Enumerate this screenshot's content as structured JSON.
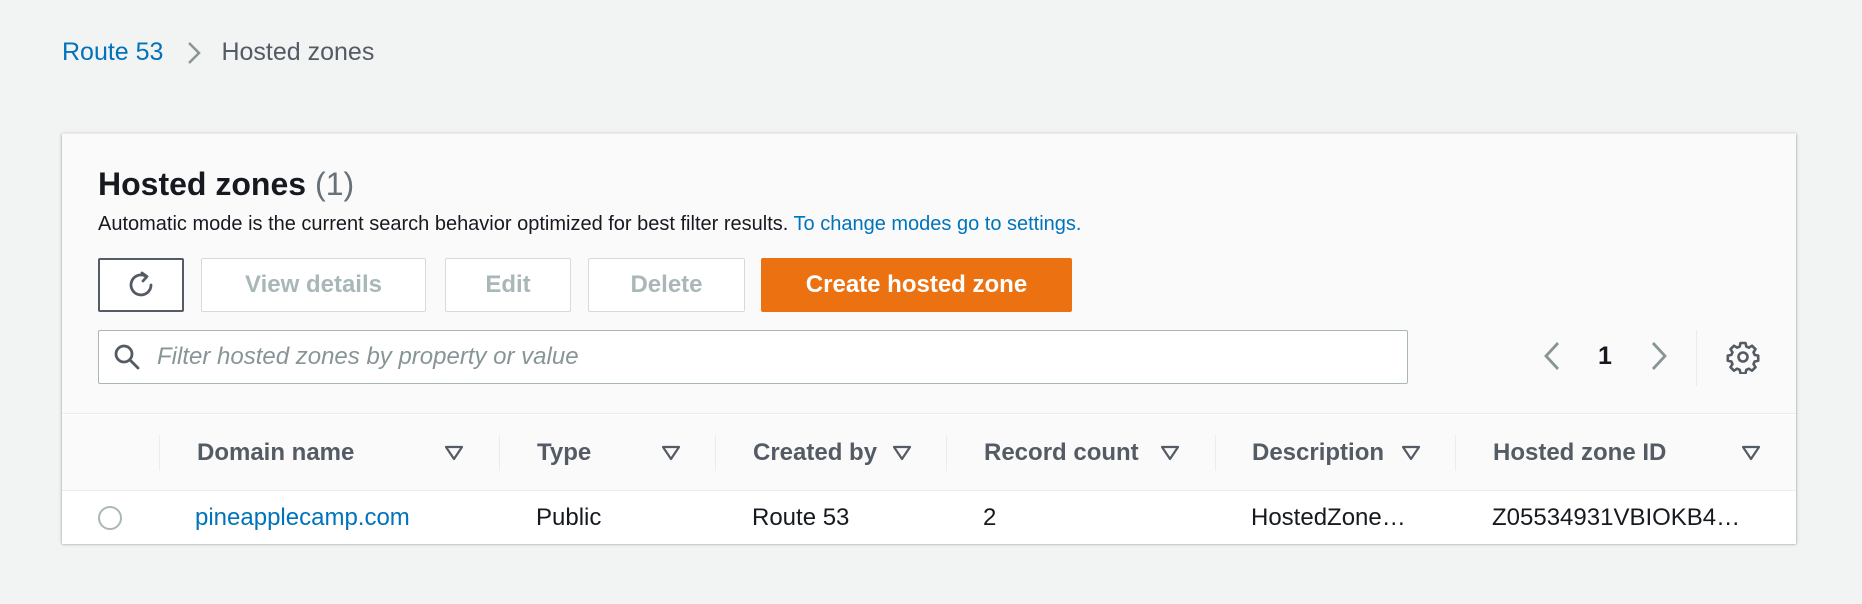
{
  "breadcrumb": {
    "root": "Route 53",
    "current": "Hosted zones"
  },
  "panel": {
    "title": "Hosted zones",
    "count": "(1)",
    "subtitle_text": "Automatic mode is the current search behavior optimized for best filter results.",
    "subtitle_link": "To change modes go to settings."
  },
  "toolbar": {
    "view_details": "View details",
    "edit": "Edit",
    "delete": "Delete",
    "create": "Create hosted zone"
  },
  "search": {
    "placeholder": "Filter hosted zones by property or value",
    "value": ""
  },
  "pagination": {
    "page": "1"
  },
  "table": {
    "columns": [
      "Domain name",
      "Type",
      "Created by",
      "Record count",
      "Description",
      "Hosted zone ID"
    ],
    "rows": [
      {
        "domain": "pineapplecamp.com",
        "type": "Public",
        "created_by": "Route 53",
        "record_count": "2",
        "description": "HostedZone…",
        "zone_id": "Z05534931VBIOKB4…"
      }
    ]
  },
  "colors": {
    "link": "#0073bb",
    "primary": "#ec7211",
    "disabled_text": "#aab7b8",
    "header_text": "#545b64"
  },
  "icons": {
    "breadcrumb_separator": "chevron-right-icon",
    "refresh": "refresh-icon",
    "search": "search-icon",
    "prev": "chevron-left-icon",
    "next": "chevron-right-icon",
    "settings": "gear-icon",
    "sort": "sort-down-icon"
  }
}
